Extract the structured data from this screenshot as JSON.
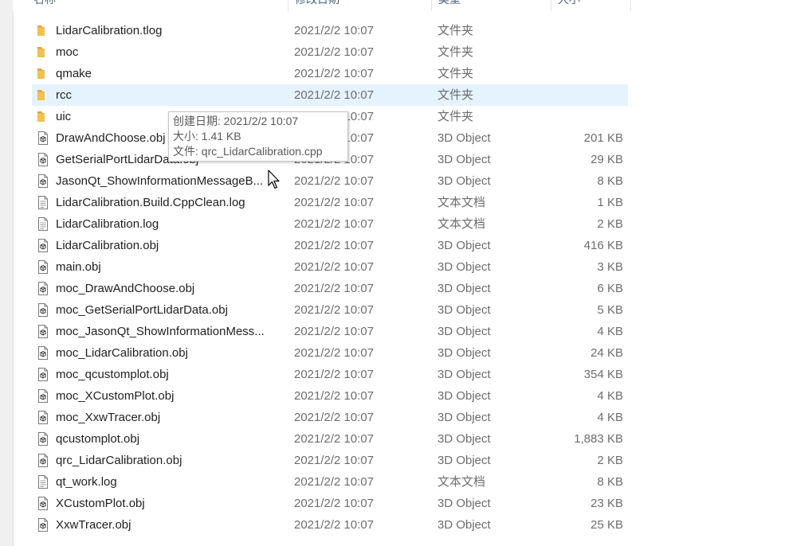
{
  "header": {
    "name": "名称",
    "modified": "修改日期",
    "type": "类型",
    "size": "大小"
  },
  "files": [
    {
      "name": "LidarCalibration.tlog",
      "date": "2021/2/2 10:07",
      "type": "文件夹",
      "size": "",
      "kind": "folder"
    },
    {
      "name": "moc",
      "date": "2021/2/2 10:07",
      "type": "文件夹",
      "size": "",
      "kind": "folder"
    },
    {
      "name": "qmake",
      "date": "2021/2/2 10:07",
      "type": "文件夹",
      "size": "",
      "kind": "folder"
    },
    {
      "name": "rcc",
      "date": "2021/2/2 10:07",
      "type": "文件夹",
      "size": "",
      "kind": "folder"
    },
    {
      "name": "uic",
      "date": "2021/2/2 10:07",
      "type": "文件夹",
      "size": "",
      "kind": "folder"
    },
    {
      "name": "DrawAndChoose.obj",
      "date": "2021/2/2 10:07",
      "type": "3D Object",
      "size": "201 KB",
      "kind": "obj"
    },
    {
      "name": "GetSerialPortLidarData.obj",
      "date": "2021/2/2 10:07",
      "type": "3D Object",
      "size": "29 KB",
      "kind": "obj"
    },
    {
      "name": "JasonQt_ShowInformationMessageB...",
      "date": "2021/2/2 10:07",
      "type": "3D Object",
      "size": "8 KB",
      "kind": "obj"
    },
    {
      "name": "LidarCalibration.Build.CppClean.log",
      "date": "2021/2/2 10:07",
      "type": "文本文档",
      "size": "1 KB",
      "kind": "text"
    },
    {
      "name": "LidarCalibration.log",
      "date": "2021/2/2 10:07",
      "type": "文本文档",
      "size": "2 KB",
      "kind": "text"
    },
    {
      "name": "LidarCalibration.obj",
      "date": "2021/2/2 10:07",
      "type": "3D Object",
      "size": "416 KB",
      "kind": "obj"
    },
    {
      "name": "main.obj",
      "date": "2021/2/2 10:07",
      "type": "3D Object",
      "size": "3 KB",
      "kind": "obj"
    },
    {
      "name": "moc_DrawAndChoose.obj",
      "date": "2021/2/2 10:07",
      "type": "3D Object",
      "size": "6 KB",
      "kind": "obj"
    },
    {
      "name": "moc_GetSerialPortLidarData.obj",
      "date": "2021/2/2 10:07",
      "type": "3D Object",
      "size": "5 KB",
      "kind": "obj"
    },
    {
      "name": "moc_JasonQt_ShowInformationMess...",
      "date": "2021/2/2 10:07",
      "type": "3D Object",
      "size": "4 KB",
      "kind": "obj"
    },
    {
      "name": "moc_LidarCalibration.obj",
      "date": "2021/2/2 10:07",
      "type": "3D Object",
      "size": "24 KB",
      "kind": "obj"
    },
    {
      "name": "moc_qcustomplot.obj",
      "date": "2021/2/2 10:07",
      "type": "3D Object",
      "size": "354 KB",
      "kind": "obj"
    },
    {
      "name": "moc_XCustomPlot.obj",
      "date": "2021/2/2 10:07",
      "type": "3D Object",
      "size": "4 KB",
      "kind": "obj"
    },
    {
      "name": "moc_XxwTracer.obj",
      "date": "2021/2/2 10:07",
      "type": "3D Object",
      "size": "4 KB",
      "kind": "obj"
    },
    {
      "name": "qcustomplot.obj",
      "date": "2021/2/2 10:07",
      "type": "3D Object",
      "size": "1,883 KB",
      "kind": "obj"
    },
    {
      "name": "qrc_LidarCalibration.obj",
      "date": "2021/2/2 10:07",
      "type": "3D Object",
      "size": "2 KB",
      "kind": "obj"
    },
    {
      "name": "qt_work.log",
      "date": "2021/2/2 10:07",
      "type": "文本文档",
      "size": "8 KB",
      "kind": "text"
    },
    {
      "name": "XCustomPlot.obj",
      "date": "2021/2/2 10:07",
      "type": "3D Object",
      "size": "23 KB",
      "kind": "obj"
    },
    {
      "name": "XxwTracer.obj",
      "date": "2021/2/2 10:07",
      "type": "3D Object",
      "size": "25 KB",
      "kind": "obj"
    }
  ],
  "selected_name": "rcc",
  "tooltip": {
    "line1": "创建日期: 2021/2/2 10:07",
    "line2": "大小: 1.41 KB",
    "line3": "文件: qrc_LidarCalibration.cpp"
  },
  "colors": {
    "folder": "#f2c14e",
    "selected_row": "#e5f3ff",
    "secondary_text": "#6d6d6d"
  },
  "icons": {
    "folder": "folder-icon",
    "obj": "3d-object-file-icon",
    "text": "text-document-icon",
    "cursor": "mouse-pointer-icon"
  }
}
